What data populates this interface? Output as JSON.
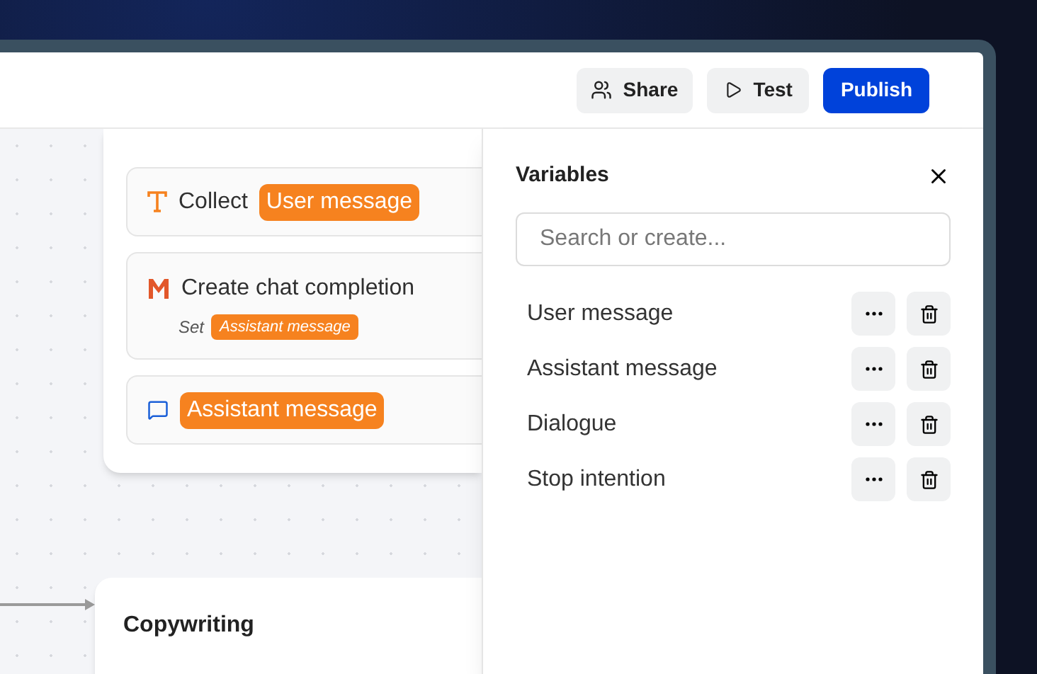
{
  "header": {
    "buttons": [
      {
        "kind": "share",
        "label": "Share"
      },
      {
        "kind": "test",
        "label": "Test"
      },
      {
        "kind": "publish",
        "label": "Publish"
      }
    ]
  },
  "canvas": {
    "group": {
      "blocks": [
        {
          "kind": "collect",
          "label": "Collect",
          "variable": "User message"
        },
        {
          "kind": "openai",
          "label": "Create chat completion",
          "set_label": "Set",
          "variable": "Assistant message"
        },
        {
          "kind": "bubble",
          "variable": "Assistant message"
        }
      ]
    },
    "copywriting": {
      "title": "Copywriting"
    }
  },
  "variables_panel": {
    "title": "Variables",
    "search": {
      "placeholder": "Search or create..."
    },
    "items": [
      {
        "name": "User message"
      },
      {
        "name": "Assistant message"
      },
      {
        "name": "Dialogue"
      },
      {
        "name": "Stop intention"
      }
    ]
  }
}
